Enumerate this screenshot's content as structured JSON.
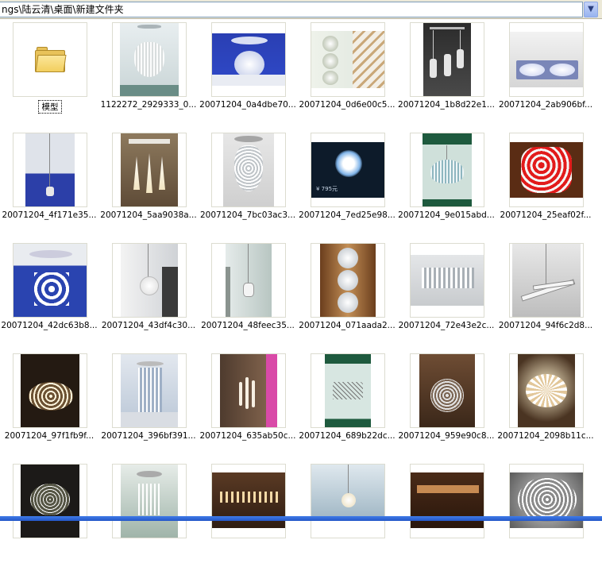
{
  "address_bar": {
    "path": "ngs\\陆云清\\桌面\\新建文件夹",
    "dropdown_icon": "chevron-down-icon"
  },
  "folder": {
    "label": "模型",
    "icon": "folder-icon"
  },
  "files": [
    "1122272_2929333_0...",
    "20071204_0a4dbe70...",
    "20071204_0d6e00c5...",
    "20071204_1b8d22e1...",
    "20071204_2ab906bf...",
    "20071204_4f171e35...",
    "20071204_5aa9038a...",
    "20071204_7bc03ac3...",
    "20071204_7ed25e98...",
    "20071204_9e015abd...",
    "20071204_25eaf02f...",
    "20071204_42dc63b8...",
    "20071204_43df4c30...",
    "20071204_48feec35...",
    "20071204_071aada2...",
    "20071204_72e43e2c...",
    "20071204_94f6c2d8...",
    "20071204_97f1fb9f...",
    "20071204_396bf391...",
    "20071204_635ab50c...",
    "20071204_689b22dc...",
    "20071204_959e90c8...",
    "20071204_2098b11c...",
    "",
    "",
    "",
    "",
    "",
    ""
  ],
  "thumb_texts": {
    "price_795": "¥ 795元"
  }
}
